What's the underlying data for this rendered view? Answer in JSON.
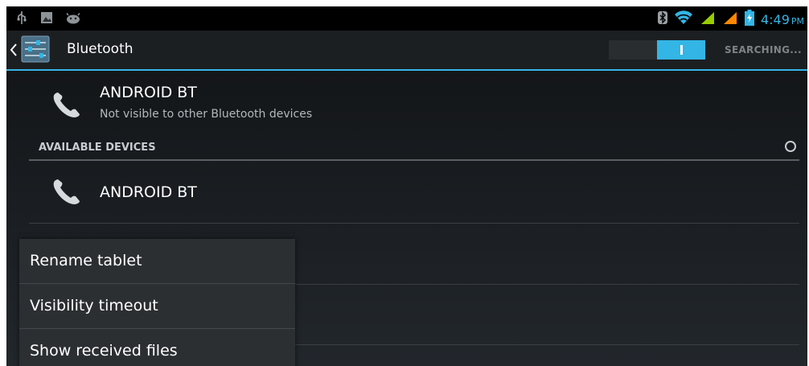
{
  "status_bar": {
    "time": "4:49",
    "ampm": "PM",
    "icons_left": [
      "usb-icon",
      "image-notification-icon",
      "android-debug-icon"
    ],
    "icons_right": [
      "bluetooth-icon",
      "wifi-icon",
      "signal-icon",
      "signal-icon-2",
      "battery-charging-icon"
    ]
  },
  "action_bar": {
    "title": "Bluetooth",
    "toggle_state": "on",
    "status": "SEARCHING..."
  },
  "this_device": {
    "name": "ANDROID BT",
    "subtitle": "Not visible to other Bluetooth devices"
  },
  "available_devices": {
    "header": "AVAILABLE DEVICES",
    "items": [
      {
        "name": "ANDROID BT"
      }
    ]
  },
  "menu": {
    "items": [
      {
        "label": "Rename tablet"
      },
      {
        "label": "Visibility timeout"
      },
      {
        "label": "Show received files"
      }
    ]
  },
  "colors": {
    "accent": "#33b5e5",
    "status_green": "#99cc00",
    "status_orange": "#ff8800"
  }
}
